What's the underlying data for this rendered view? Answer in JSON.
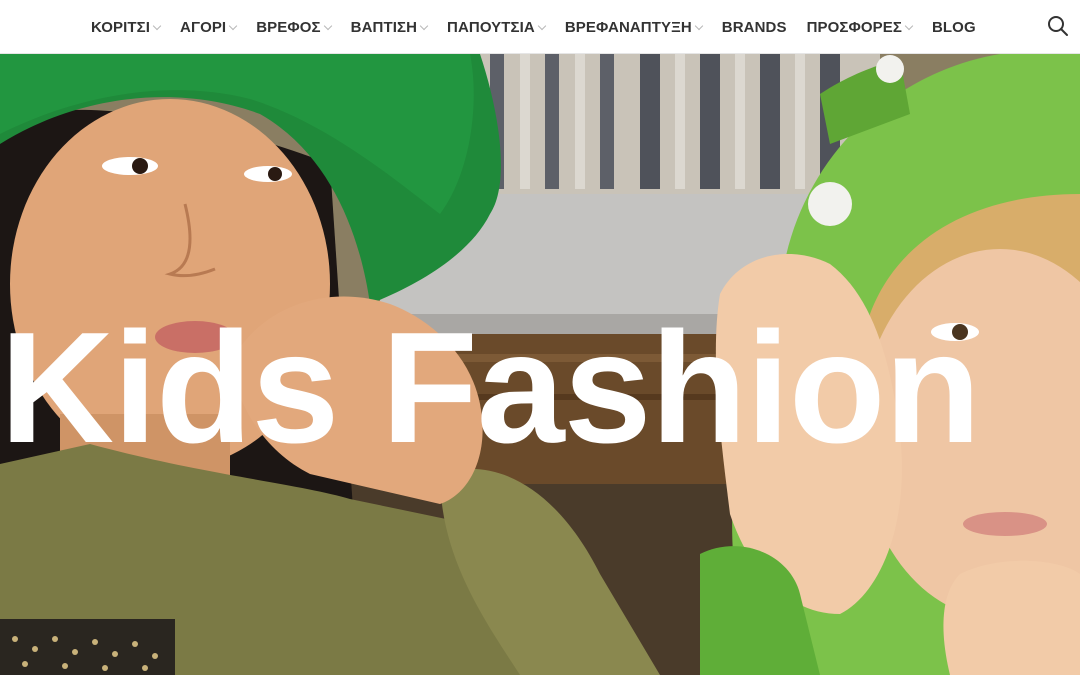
{
  "nav": {
    "items": [
      {
        "label": "ΚΟΡΙΤΣΙ",
        "has_dropdown": true
      },
      {
        "label": "ΑΓΟΡΙ",
        "has_dropdown": true
      },
      {
        "label": "ΒΡΕΦΟΣ",
        "has_dropdown": true
      },
      {
        "label": "ΒΑΠΤΙΣΗ",
        "has_dropdown": true
      },
      {
        "label": "ΠΑΠΟΥΤΣΙΑ",
        "has_dropdown": true
      },
      {
        "label": "ΒΡΕΦΑΝΑΠΤΥΞΗ",
        "has_dropdown": true
      },
      {
        "label": "BRANDS",
        "has_dropdown": false
      },
      {
        "label": "ΠΡΟΣΦΟΡΕΣ",
        "has_dropdown": true
      },
      {
        "label": "BLOG",
        "has_dropdown": false
      }
    ],
    "search_icon": "search-icon"
  },
  "hero": {
    "title": "Kids Fashion"
  },
  "colors": {
    "nav_text": "#333333",
    "hero_text": "#ffffff",
    "hat_green": "#1f8a3a",
    "knit_green": "#7cc24a",
    "sweater_olive": "#7b7a45"
  }
}
